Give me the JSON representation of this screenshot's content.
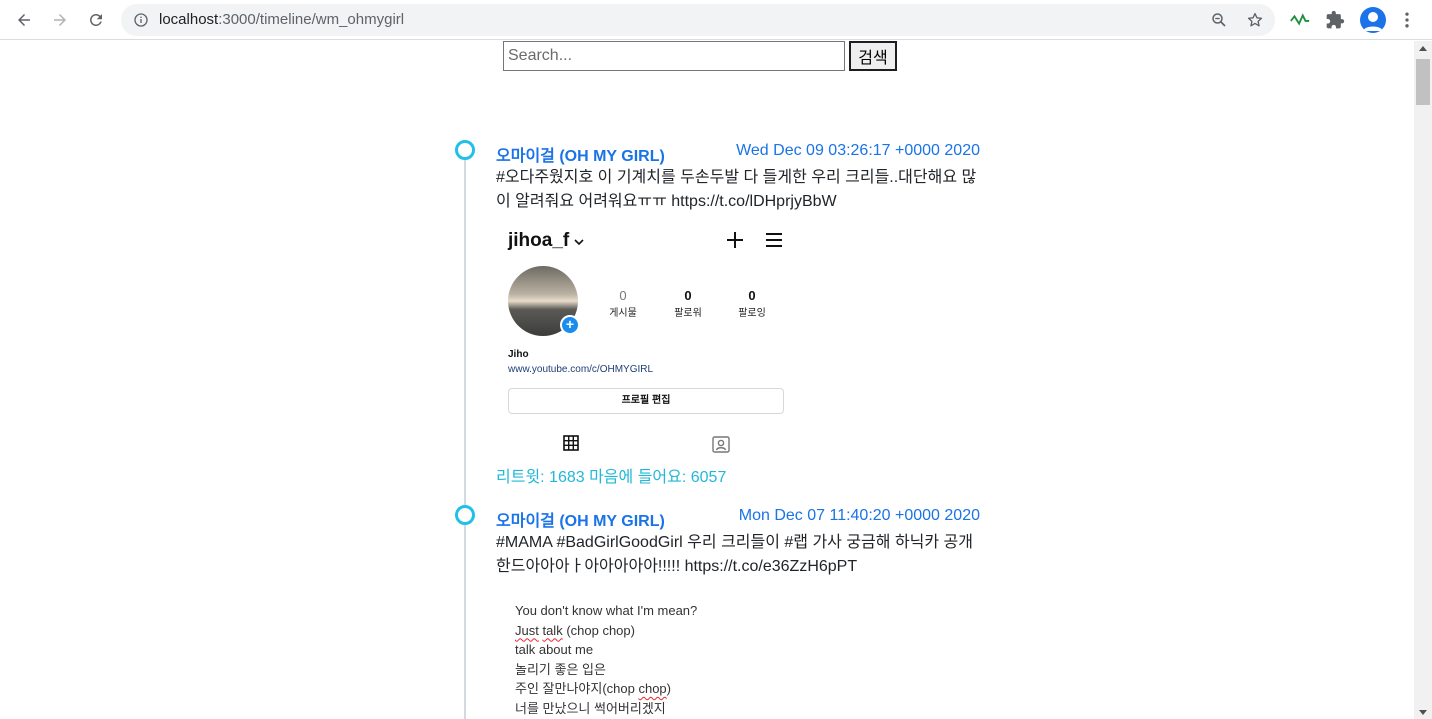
{
  "browser": {
    "url_host": "localhost",
    "url_path": ":3000/timeline/wm_ohmygirl",
    "icons": [
      "back-arrow-icon",
      "forward-arrow-icon",
      "reload-icon",
      "site-info-icon",
      "zoom-icon",
      "bookmark-star-icon",
      "extension-pulse-icon",
      "extensions-puzzle-icon",
      "profile-avatar",
      "more-vert-icon"
    ]
  },
  "search": {
    "placeholder": "Search...",
    "value": "",
    "button_label": "검색"
  },
  "colors": {
    "link_blue": "#1a73e8",
    "timeline_dot": "#22c0e8",
    "stats_cyan": "#22b8d8",
    "timeline_line": "#d4d9df"
  },
  "tweets": [
    {
      "author": "오마이걸 (OH MY GIRL)",
      "date": "Wed Dec 09 03:26:17 +0000 2020",
      "text": "#오다주웠지호 이 기계치를 두손두발 다 들게한 우리 크리들..대단해요 많이 알려줘요 어려워요ㅠㅠ https://t.co/lDHprjyBbW",
      "stats": "리트윗: 1683 마음에 들어요: 6057",
      "media": {
        "username": "jihoa_f",
        "posts_count": "0",
        "posts_label": "게시물",
        "followers_count": "0",
        "followers_label": "팔로워",
        "following_count": "0",
        "following_label": "팔로잉",
        "name": "Jiho",
        "link": "www.youtube.com/c/OHMYGIRL",
        "edit_button": "프로필 편집"
      }
    },
    {
      "author": "오마이걸 (OH MY GIRL)",
      "date": "Mon Dec 07 11:40:20 +0000 2020",
      "text": "#MAMA #BadGirlGoodGirl 우리 크리들이 #랩 가사 궁금해 하닉카 공개한드아아아ㅏ아아아아아!!!!! https://t.co/e36ZzH6pPT",
      "media": {
        "line1": "You don't know what I'm mean?",
        "line2_a": "Just",
        "line2_b": "talk",
        "line2_c": " (chop chop)",
        "line3": "talk about me",
        "line4": "놀리기 좋은 입은",
        "line5_a": "주인 잘만나야지(chop ",
        "line5_b": "chop",
        "line5_c": ")",
        "line6": "너를 만났으니 썩어버리겠지"
      }
    }
  ]
}
